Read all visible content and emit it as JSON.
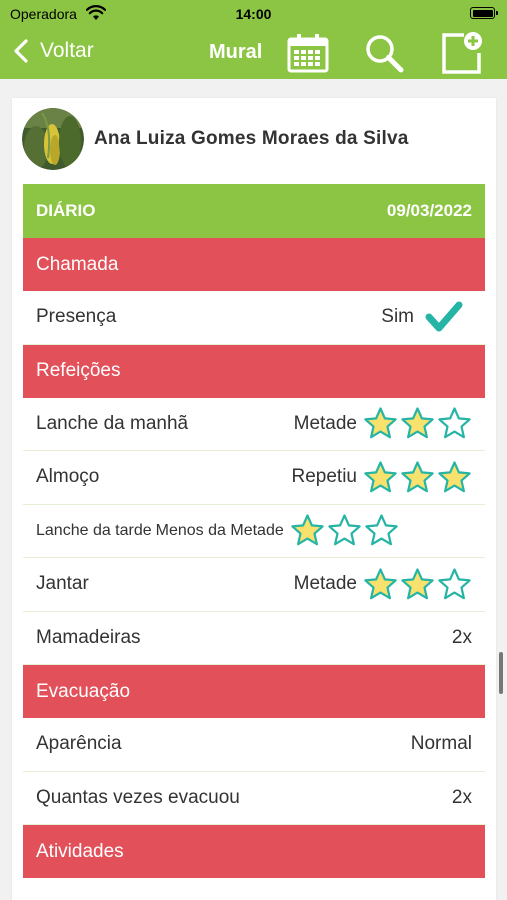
{
  "status": {
    "carrier": "Operadora",
    "time": "14:00"
  },
  "nav": {
    "back_label": "Voltar",
    "title": "Mural"
  },
  "profile": {
    "name": "Ana Luiza Gomes Moraes da Silva"
  },
  "diary": {
    "label": "DIÁRIO",
    "date": "09/03/2022"
  },
  "sections": {
    "chamada": "Chamada",
    "refeicoes": "Refeições",
    "evacuacao": "Evacuação",
    "atividades": "Atividades"
  },
  "presenca": {
    "label": "Presença",
    "value": "Sim"
  },
  "meals": [
    {
      "label": "Lanche da manhã",
      "value": "Metade",
      "rating": 2
    },
    {
      "label": "Almoço",
      "value": "Repetiu",
      "rating": 3
    },
    {
      "label": "Lanche da tarde",
      "value": "Menos da Metade",
      "rating": 1
    },
    {
      "label": "Jantar",
      "value": "Metade",
      "rating": 2
    }
  ],
  "mamadeiras": {
    "label": "Mamadeiras",
    "value": "2x"
  },
  "aparencia": {
    "label": "Aparência",
    "value": "Normal"
  },
  "evacuou": {
    "label": "Quantas vezes evacuou",
    "value": "2x"
  },
  "colors": {
    "brand_green": "#8cc543",
    "section_red": "#e2505a",
    "star_fill": "#f8e16c",
    "star_stroke": "#25b4a5",
    "check": "#25b4a5"
  }
}
